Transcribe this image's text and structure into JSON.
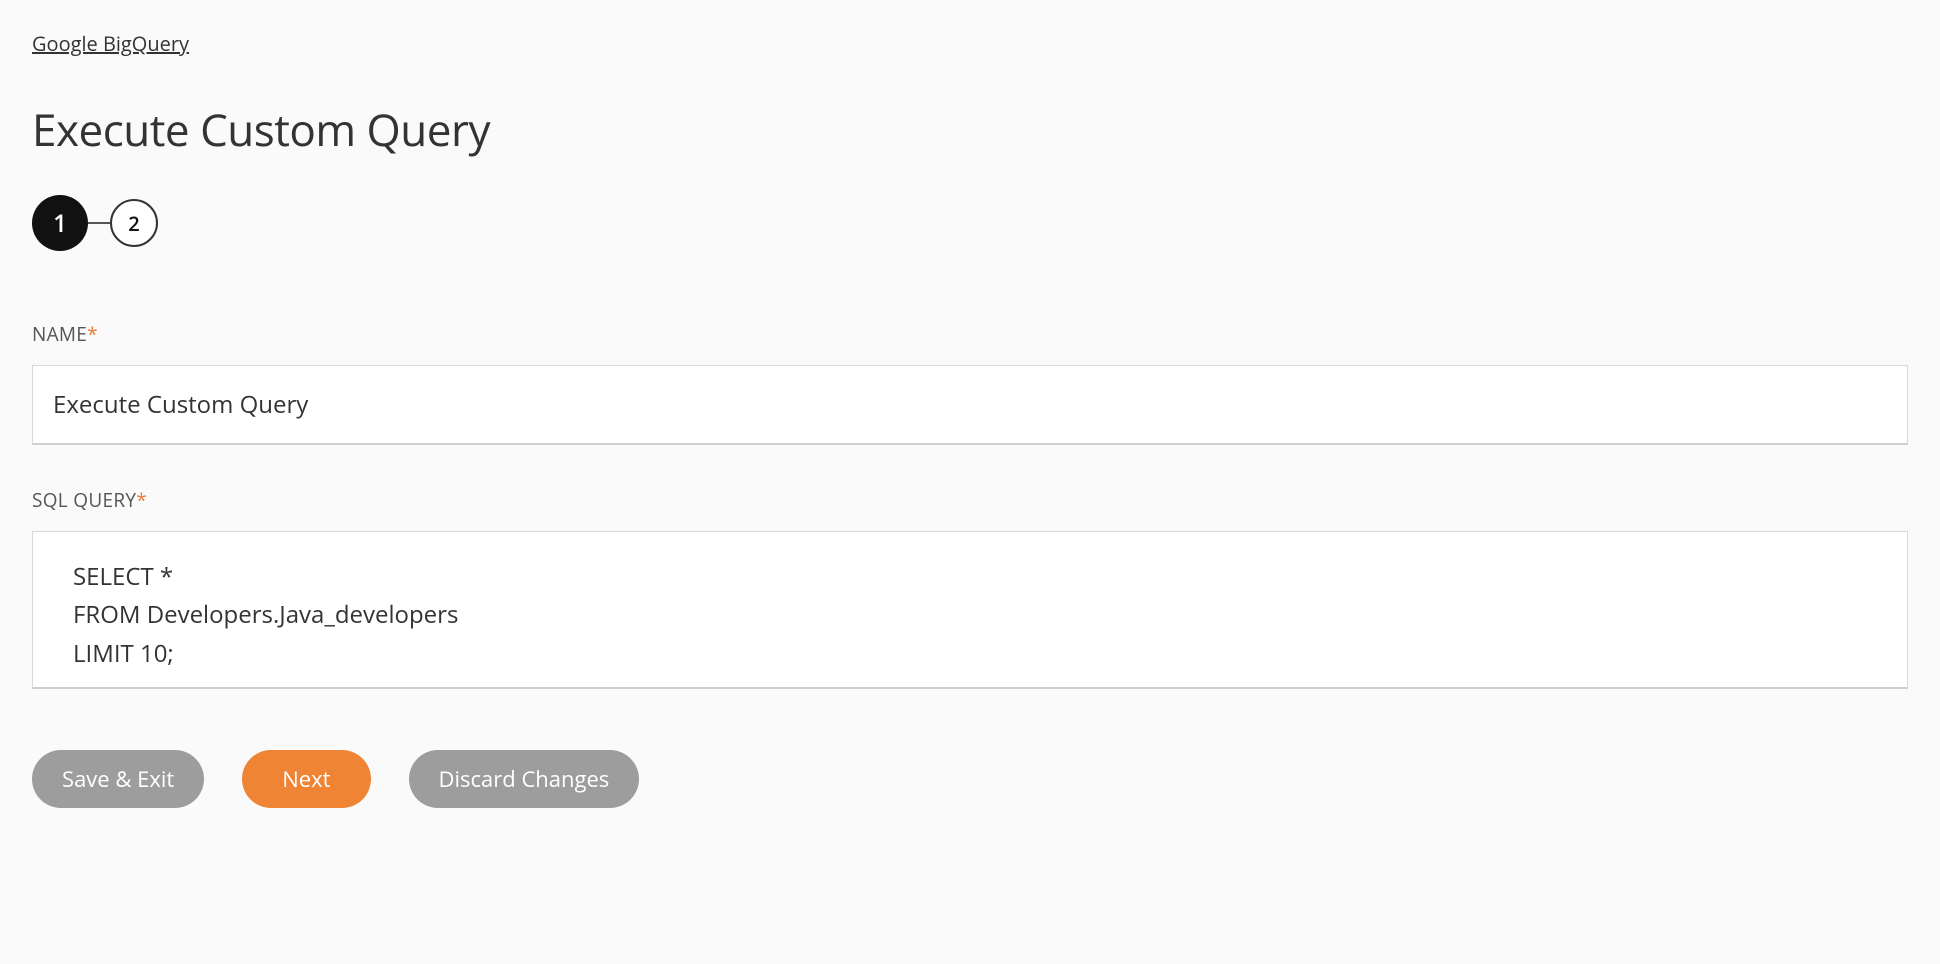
{
  "breadcrumb": {
    "label": "Google BigQuery"
  },
  "page": {
    "title": "Execute Custom Query"
  },
  "stepper": {
    "steps": [
      "1",
      "2"
    ],
    "activeIndex": 0
  },
  "form": {
    "name": {
      "label": "NAME",
      "required": "*",
      "value": "Execute Custom Query"
    },
    "sql": {
      "label": "SQL QUERY",
      "required": "*",
      "value": "SELECT *\nFROM Developers.Java_developers\nLIMIT 10;"
    }
  },
  "buttons": {
    "save_exit": "Save & Exit",
    "next": "Next",
    "discard": "Discard Changes"
  }
}
